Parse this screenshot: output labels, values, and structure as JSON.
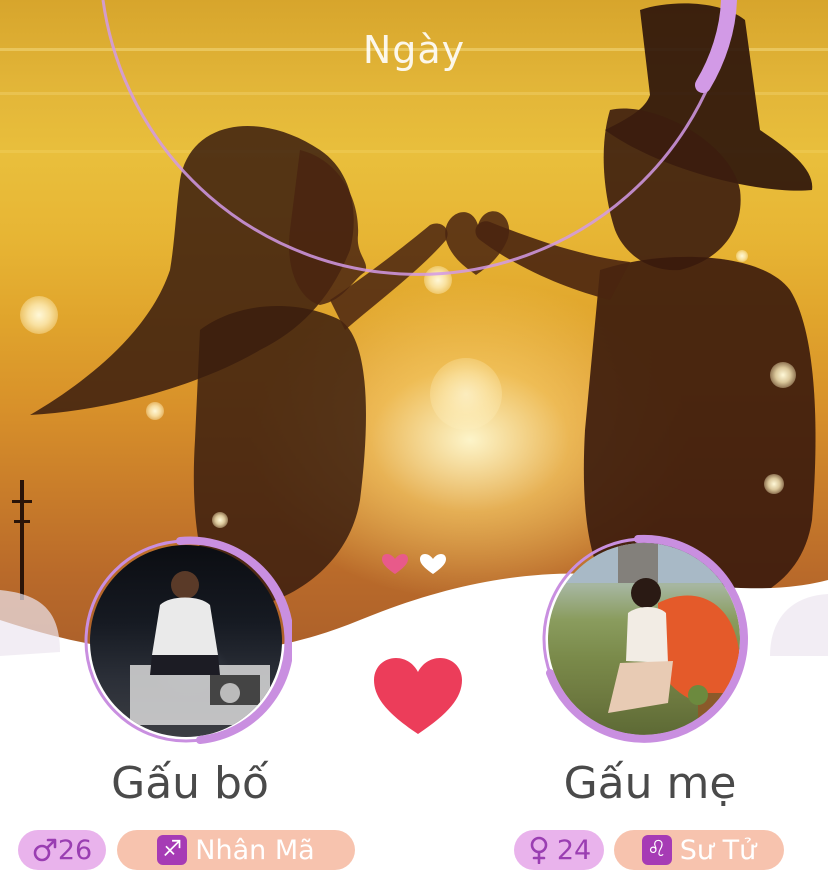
{
  "counter": {
    "unit_label": "Ngày"
  },
  "couple": {
    "father": {
      "name": "Gấu bố",
      "gender_icon": "male-symbol-icon",
      "age": "26",
      "zodiac_icon": "sagittarius-icon",
      "zodiac_name": "Nhân Mã"
    },
    "mother": {
      "name": "Gấu mẹ",
      "gender_icon": "female-symbol-icon",
      "age": "24",
      "zodiac_icon": "leo-icon",
      "zodiac_name": "Sư Tử"
    }
  },
  "pager": {
    "active_index": 0,
    "count": 2
  },
  "colors": {
    "accent_pink": "#e85a8a",
    "arc_violet": "#d29ae6",
    "heart_red": "#ec3d5a",
    "age_badge_bg": "#e9b3ec",
    "age_badge_text": "#9a3eb2",
    "zodiac_badge_bg": "#f7c3ae",
    "zodiac_tile": "#a63bb5"
  }
}
